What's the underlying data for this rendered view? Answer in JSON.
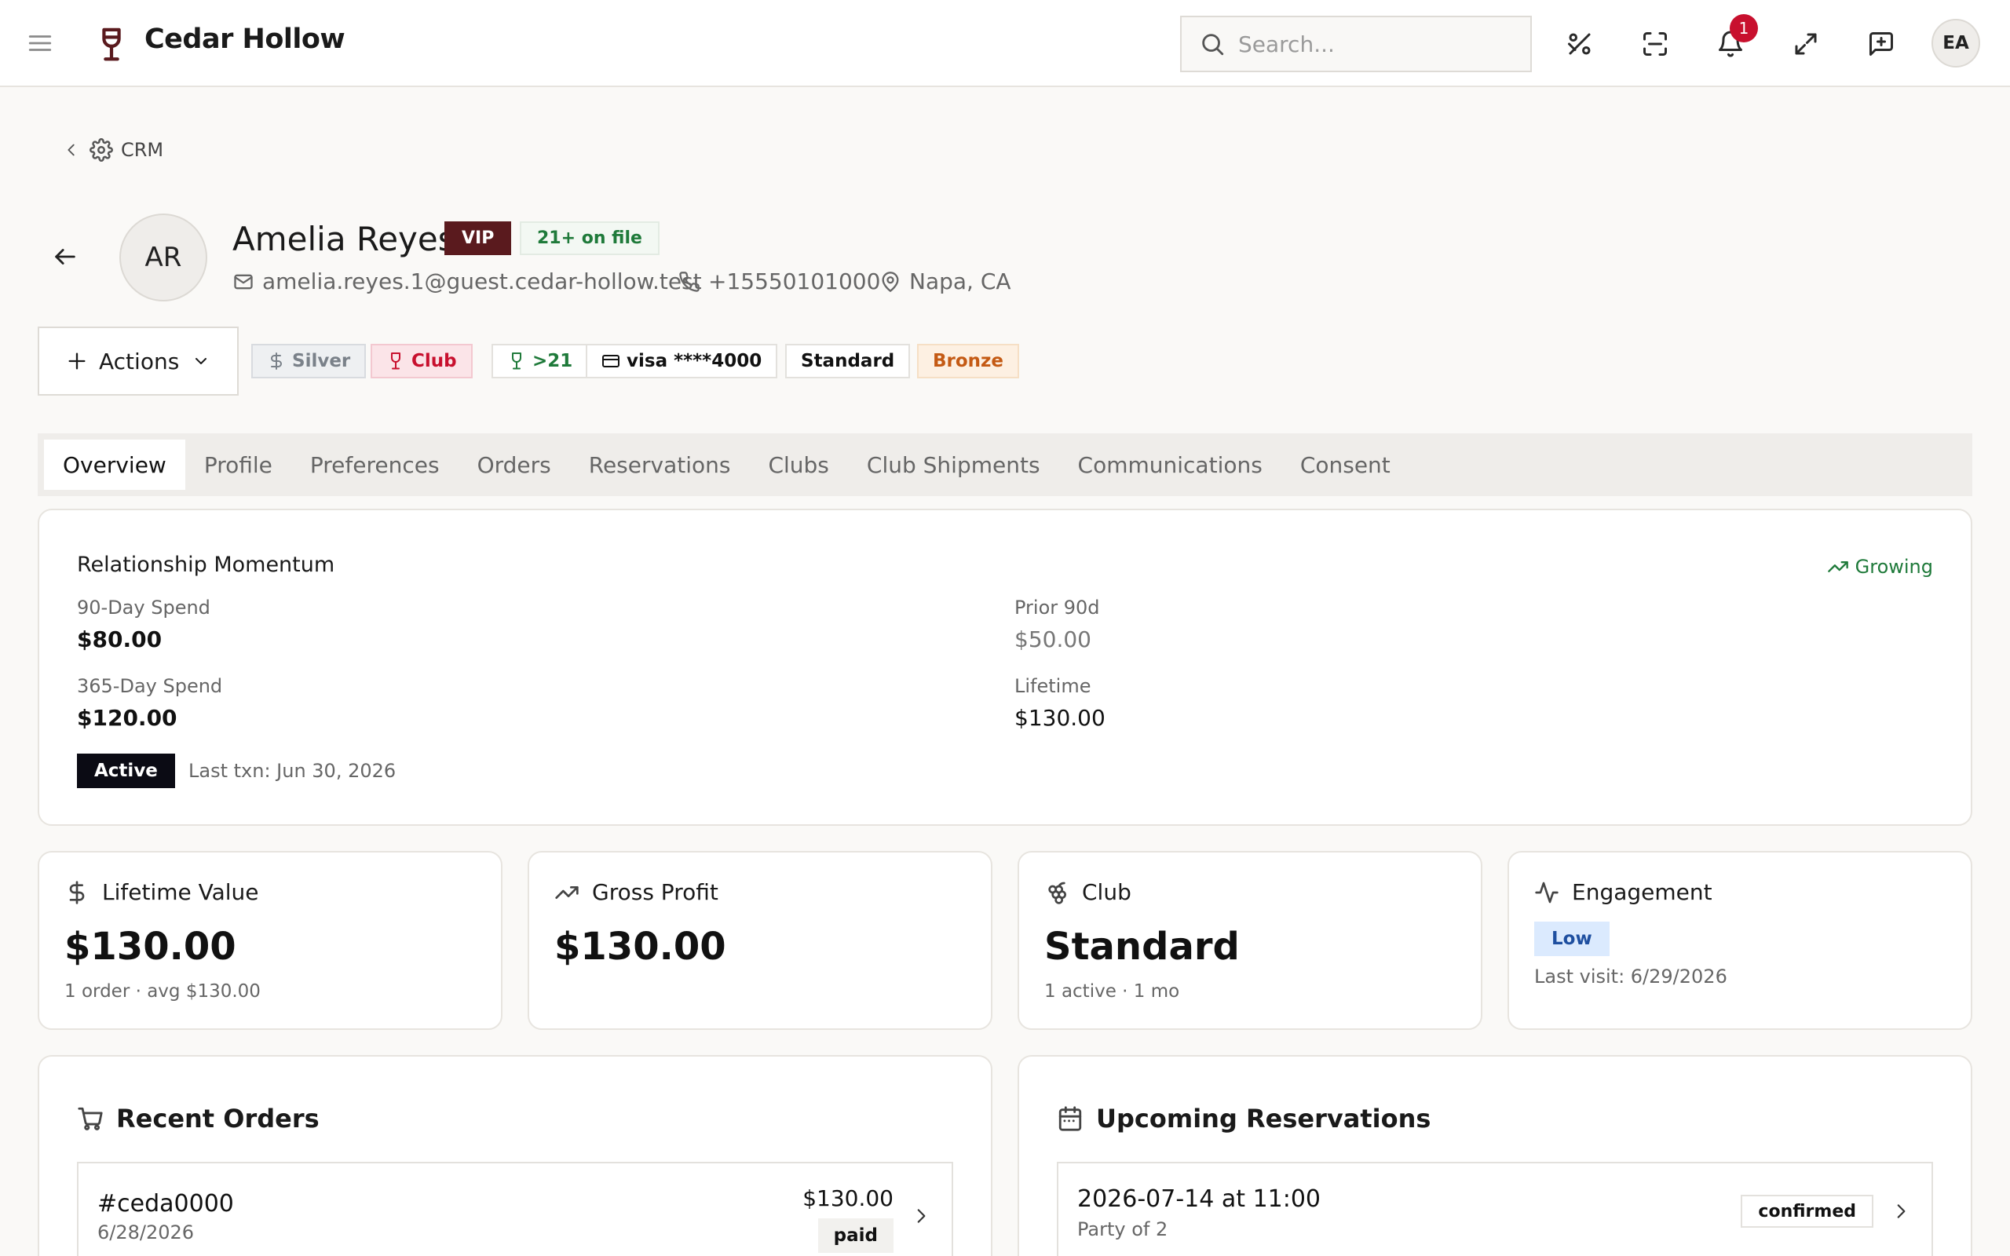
{
  "header": {
    "brand": "Cedar Hollow",
    "search_placeholder": "Search...",
    "notification_count": "1",
    "user_initials": "EA"
  },
  "breadcrumb": {
    "label": "CRM"
  },
  "customer": {
    "initials": "AR",
    "name": "Amelia Reyes",
    "vip_label": "VIP",
    "age_label": "21+ on file",
    "email": "amelia.reyes.1@guest.cedar-hollow.test",
    "phone": "+15550101000",
    "location": "Napa, CA"
  },
  "actions_label": "Actions",
  "chips": {
    "silver": "Silver",
    "club": "Club",
    "age": ">21",
    "card": "visa ****4000",
    "standard": "Standard",
    "bronze": "Bronze"
  },
  "tabs": [
    "Overview",
    "Profile",
    "Preferences",
    "Orders",
    "Reservations",
    "Clubs",
    "Club Shipments",
    "Communications",
    "Consent"
  ],
  "momentum": {
    "title": "Relationship Momentum",
    "trend": "Growing",
    "spend_90_label": "90-Day Spend",
    "spend_90_value": "$80.00",
    "prior_90_label": "Prior 90d",
    "prior_90_value": "$50.00",
    "spend_365_label": "365-Day Spend",
    "spend_365_value": "$120.00",
    "lifetime_label": "Lifetime",
    "lifetime_value": "$130.00",
    "status": "Active",
    "last_txn": "Last txn: Jun 30, 2026"
  },
  "stats": {
    "ltv": {
      "label": "Lifetime Value",
      "value": "$130.00",
      "sub": "1 order · avg $130.00"
    },
    "gross": {
      "label": "Gross Profit",
      "value": "$130.00"
    },
    "club": {
      "label": "Club",
      "value": "Standard",
      "sub": "1 active · 1 mo"
    },
    "engagement": {
      "label": "Engagement",
      "level": "Low",
      "last_visit": "Last visit: 6/29/2026"
    }
  },
  "recent_orders": {
    "title": "Recent Orders",
    "items": [
      {
        "number": "#ceda0000",
        "date": "6/28/2026",
        "amount": "$130.00",
        "status": "paid"
      }
    ]
  },
  "reservations": {
    "title": "Upcoming Reservations",
    "items": [
      {
        "datetime": "2026-07-14 at 11:00",
        "party": "Party of 2",
        "status": "confirmed"
      }
    ]
  }
}
